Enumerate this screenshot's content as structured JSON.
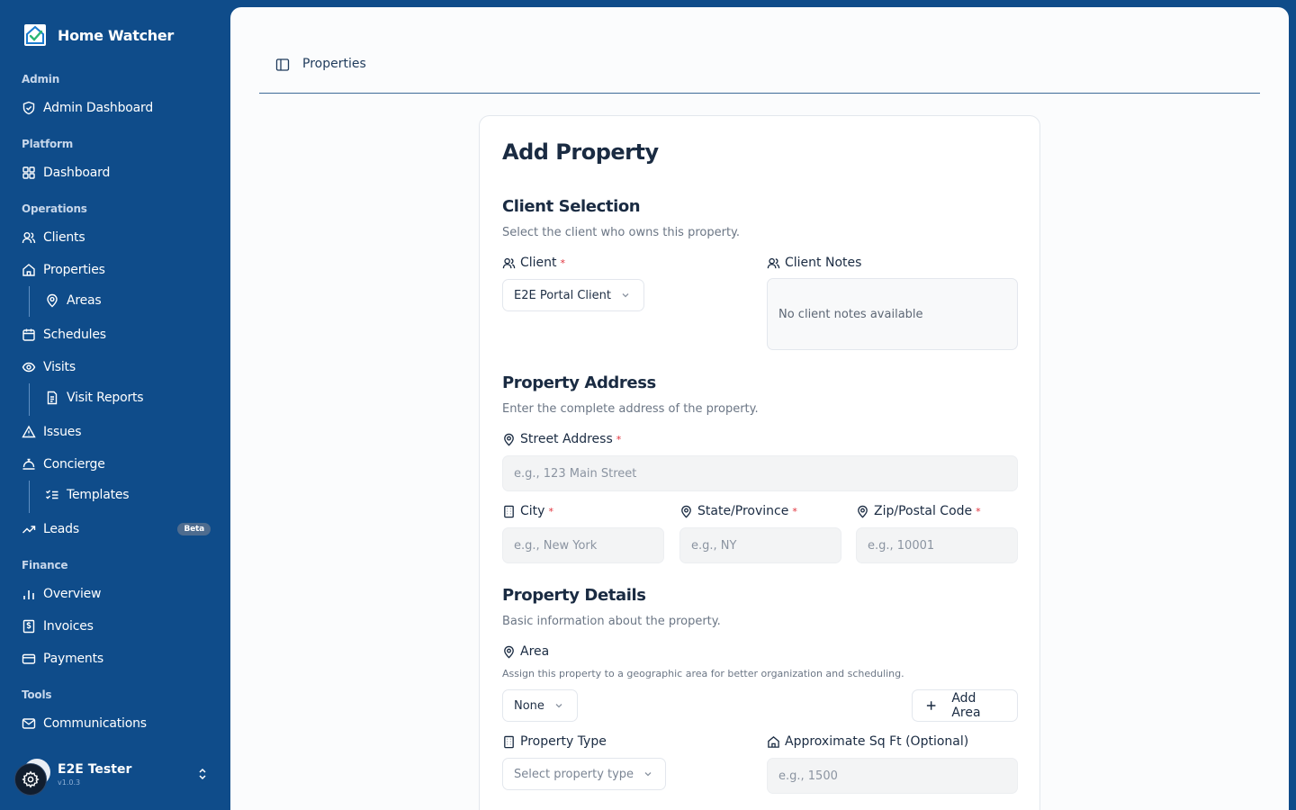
{
  "app": {
    "name": "Home Watcher"
  },
  "sidebar": {
    "groups": {
      "admin": "Admin",
      "platform": "Platform",
      "operations": "Operations",
      "finance": "Finance",
      "tools": "Tools"
    },
    "items": {
      "admin_dashboard": "Admin Dashboard",
      "dashboard": "Dashboard",
      "clients": "Clients",
      "properties": "Properties",
      "areas": "Areas",
      "schedules": "Schedules",
      "visits": "Visits",
      "visit_reports": "Visit Reports",
      "issues": "Issues",
      "concierge": "Concierge",
      "templates": "Templates",
      "leads": "Leads",
      "leads_badge": "Beta",
      "overview": "Overview",
      "invoices": "Invoices",
      "payments": "Payments",
      "communications": "Communications"
    },
    "user": {
      "name": "E2E Tester",
      "version": "v1.0.3"
    }
  },
  "header": {
    "breadcrumb": "Properties"
  },
  "form": {
    "title": "Add Property",
    "client_section": {
      "title": "Client Selection",
      "description": "Select the client who owns this property.",
      "client_label": "Client",
      "client_value": "E2E Portal Client",
      "notes_label": "Client Notes",
      "notes_value": "No client notes available"
    },
    "address_section": {
      "title": "Property Address",
      "description": "Enter the complete address of the property.",
      "street_label": "Street Address",
      "street_placeholder": "e.g., 123 Main Street",
      "city_label": "City",
      "city_placeholder": "e.g., New York",
      "state_label": "State/Province",
      "state_placeholder": "e.g., NY",
      "zip_label": "Zip/Postal Code",
      "zip_placeholder": "e.g., 10001"
    },
    "details_section": {
      "title": "Property Details",
      "description": "Basic information about the property.",
      "area_label": "Area",
      "area_hint": "Assign this property to a geographic area for better organization and scheduling.",
      "area_value": "None",
      "add_area_label": "Add Area",
      "type_label": "Property Type",
      "type_placeholder": "Select property type",
      "sqft_label": "Approximate Sq Ft (Optional)",
      "sqft_placeholder": "e.g., 1500"
    },
    "required_mark": "*"
  },
  "colors": {
    "sidebar_bg": "#0f4c8a",
    "required": "#e0303a",
    "input_bg": "#f3f4f5"
  }
}
